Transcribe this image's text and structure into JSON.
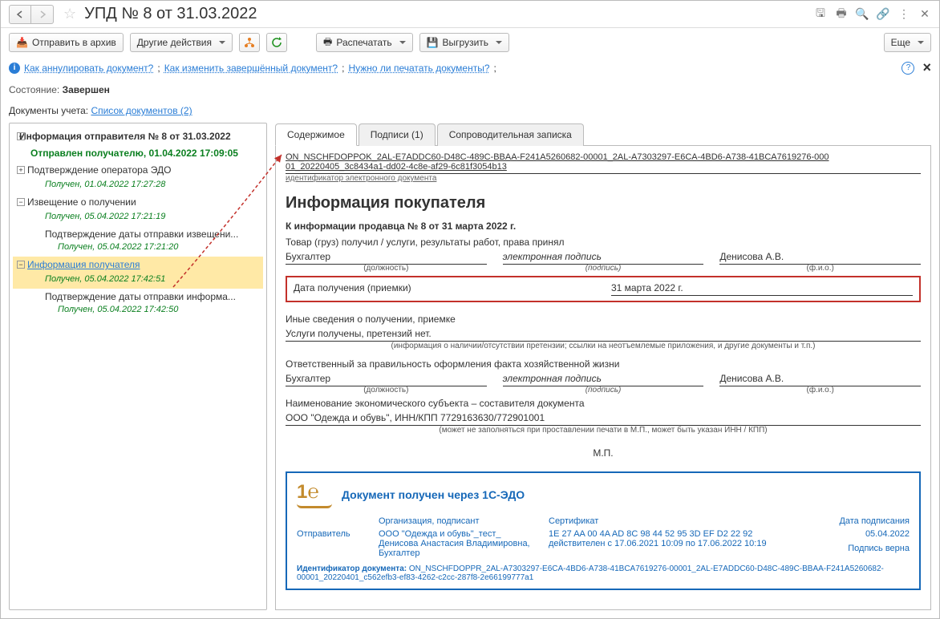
{
  "title": "УПД № 8 от 31.03.2022",
  "toolbar": {
    "archive": "Отправить в архив",
    "other": "Другие действия",
    "print": "Распечатать",
    "export": "Выгрузить",
    "more": "Еще"
  },
  "links": {
    "annul": "Как аннулировать документ?",
    "edit": "Как изменить завершённый документ?",
    "printq": "Нужно ли печатать документы?"
  },
  "state": {
    "label": "Состояние:",
    "value": "Завершен"
  },
  "docs": {
    "label": "Документы учета:",
    "link": "Список документов (2)"
  },
  "tree": {
    "root": "Информация отправителя № 8 от 31.03.2022",
    "sent": "Отправлен получателю, 01.04.2022 17:09:05",
    "n1": "Подтверждение оператора ЭДО",
    "s1": "Получен, 01.04.2022 17:27:28",
    "n2": "Извещение о получении",
    "s2": "Получен, 05.04.2022 17:21:19",
    "n3": "Подтверждение даты отправки извещени...",
    "s3": "Получен, 05.04.2022 17:21:20",
    "n4": "Информация получателя",
    "s4": "Получен, 05.04.2022 17:42:51",
    "n5": "Подтверждение даты отправки информа...",
    "s5": "Получен, 05.04.2022 17:42:50"
  },
  "tabs": {
    "t1": "Содержимое",
    "t2": "Подписи (1)",
    "t3": "Сопроводительная записка"
  },
  "doc": {
    "id1": "ON_NSCHFDOPPOK_2AL-E7ADDC60-D48C-489C-BBAA-F241A5260682-00001_2AL-A7303297-E6CA-4BD6-A738-41BCA7619276-000",
    "id2": "01_20220405_3c8434a1-dd02-4c8e-af29-6c81f3054b13",
    "idcap": "идентификатор электронного документа",
    "h": "Информация покупателя",
    "sub": "К информации продавца № 8 от 31 марта 2022 г.",
    "l1": "Товар (груз) получил / услуги, результаты работ, права принял",
    "pos": "Бухгалтер",
    "sig": "электронная подпись",
    "fio": "Денисова А.В.",
    "pos_cap": "(должность)",
    "sig_cap": "(подпись)",
    "fio_cap": "(ф.и.о.)",
    "date_lbl": "Дата получения (приемки)",
    "date_val": "31 марта 2022 г.",
    "other_head": "Иные сведения о получении, приемке",
    "other_val": "Услуги получены, претензий нет.",
    "other_cap": "(информация о наличии/отсутствии претензии; ссылки на неотъемлемые приложения, и другие документы и т.п.)",
    "resp": "Ответственный за правильность оформления факта хозяйственной жизни",
    "org_head": "Наименование экономического субъекта – составителя документа",
    "org_val": "ООО \"Одежда и обувь\", ИНН/КПП 7729163630/772901001",
    "org_cap": "(может не заполняться при проставлении печати в М.П., может быть указан ИНН / КПП)",
    "mp": "М.П."
  },
  "stamp": {
    "title": "Документ получен через 1С-ЭДО",
    "col1h": "Отправитель",
    "col2h": "Организация, подписант",
    "col2a": "ООО \"Одежда и обувь\"_тест_",
    "col2b": "Денисова Анастасия Владимировна, Бухгалтер",
    "col3h": "Сертификат",
    "col3a": "1E 27 AA 00 4A AD 8C 98 44 52 95 3D EF D2 22 92",
    "col3b": "действителен с 17.06.2021 10:09 по 17.06.2022 10:19",
    "col4h": "Дата подписания",
    "col4a": "05.04.2022",
    "col4b": "Подпись верна",
    "idlbl": "Идентификатор документа:",
    "idval": "ON_NSCHFDOPPR_2AL-A7303297-E6CA-4BD6-A738-41BCA7619276-00001_2AL-E7ADDC60-D48C-489C-BBAA-F241A5260682-00001_20220401_c562efb3-ef83-4262-c2cc-287f8-2e66199777a1"
  }
}
